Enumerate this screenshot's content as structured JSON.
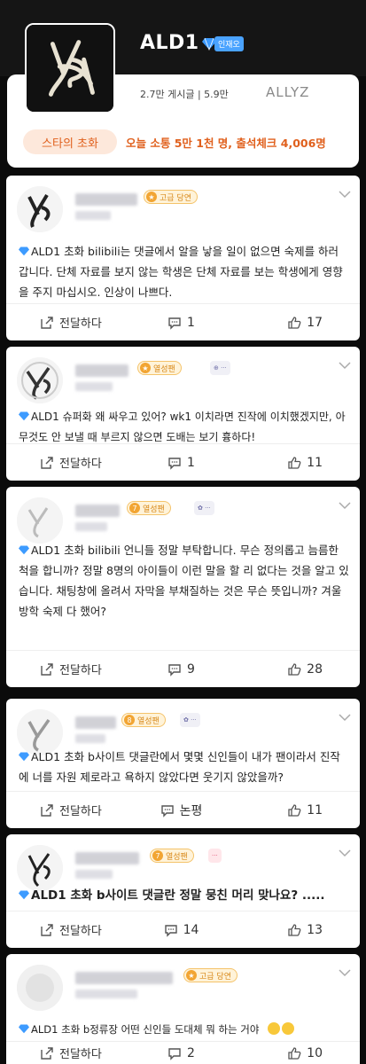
{
  "header": {
    "title": "ALD1",
    "verified_label": "인재오",
    "stats": "2.7만 게시글 | 5.9만",
    "fan_name": "ALLYZ",
    "invite_button": "스타의 초화",
    "notice": "오늘 소통 5만 1천 명, 출석체크 4,006명",
    "accent_color": "#e0601d"
  },
  "posts": [
    {
      "level_badge": "고급 당연",
      "content": "ALD1 초화 bilibili는 댓글에서 알을 낳을 일이 없으면 숙제를 하러 갑니다. 단체 자료를 보지 않는 학생은 단체 자료를 보는 학생에게 영향을 주지 마십시오. 인상이 나쁘다.",
      "share_label": "전달하다",
      "comments": "1",
      "likes": "17"
    },
    {
      "level_badge": "열성팬",
      "content": "ALD1 슈퍼화 왜 싸우고 있어? wk1 이치라면 진작에 이치했겠지만, 아무것도 안 보낼 때 부르지 않으면 도배는 보기 흉하다!",
      "share_label": "전달하다",
      "comments": "1",
      "likes": "11"
    },
    {
      "level_badge": "열성팬",
      "content": "ALD1 초화 bilibili 언니들 정말 부탁합니다. 무슨 정의롭고 늠름한 척을 합니까? 정말 8명의 아이들이 이런 말을 할 리 없다는 것을 알고 있습니다. 채팅창에 올려서 자막을 부채질하는 것은 무슨 뜻입니까? 겨울방학 숙제 다 했어?",
      "share_label": "전달하다",
      "comments": "9",
      "likes": "28"
    },
    {
      "level_badge": "열성팬",
      "content": "ALD1 초화 b사이트 댓글란에서 몇몇 신인들이 내가 팬이라서 진작에 너를 자원 제로라고 욕하지 않았다면 웃기지 않았을까?",
      "share_label": "전달하다",
      "comments": "논평",
      "likes": "11"
    },
    {
      "level_badge": "열성팬",
      "content": "ALD1 초화 b사이트 댓글란 정말 뭉친 머리 맞나요? .....",
      "share_label": "전달하다",
      "comments": "14",
      "likes": "13"
    },
    {
      "level_badge": "고급 당연",
      "content": "ALD1 초화 b정류장 어떤 신인들 도대체 뭐 하는 거야",
      "share_label": "전달하다",
      "comments": "2",
      "likes": "10"
    }
  ]
}
